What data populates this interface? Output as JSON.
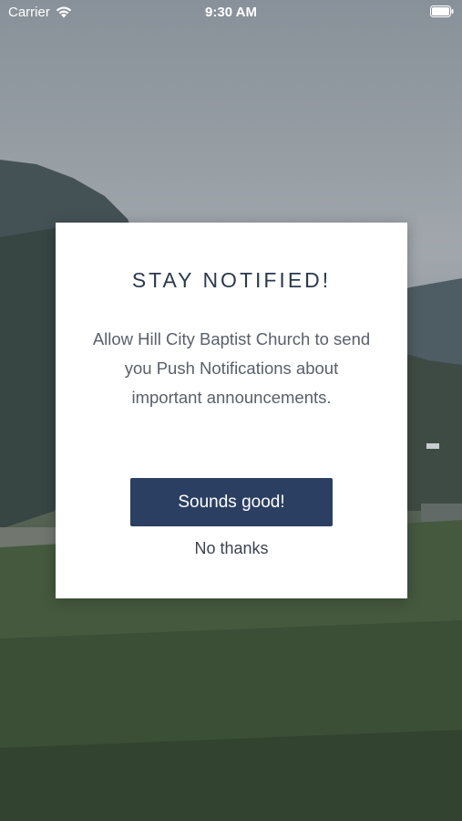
{
  "status_bar": {
    "carrier": "Carrier",
    "time": "9:30 AM",
    "icons": [
      "wifi-icon",
      "battery-icon"
    ]
  },
  "dialog": {
    "title": "STAY NOTIFIED!",
    "message": "Allow Hill City Baptist Church to send you Push Notifications about important announcements.",
    "primary_label": "Sounds good!",
    "secondary_label": "No thanks"
  },
  "colors": {
    "primary_button": "#2b3f62",
    "title_text": "#2b3a4d",
    "body_text": "#59606a",
    "dialog_bg": "#ffffff"
  }
}
